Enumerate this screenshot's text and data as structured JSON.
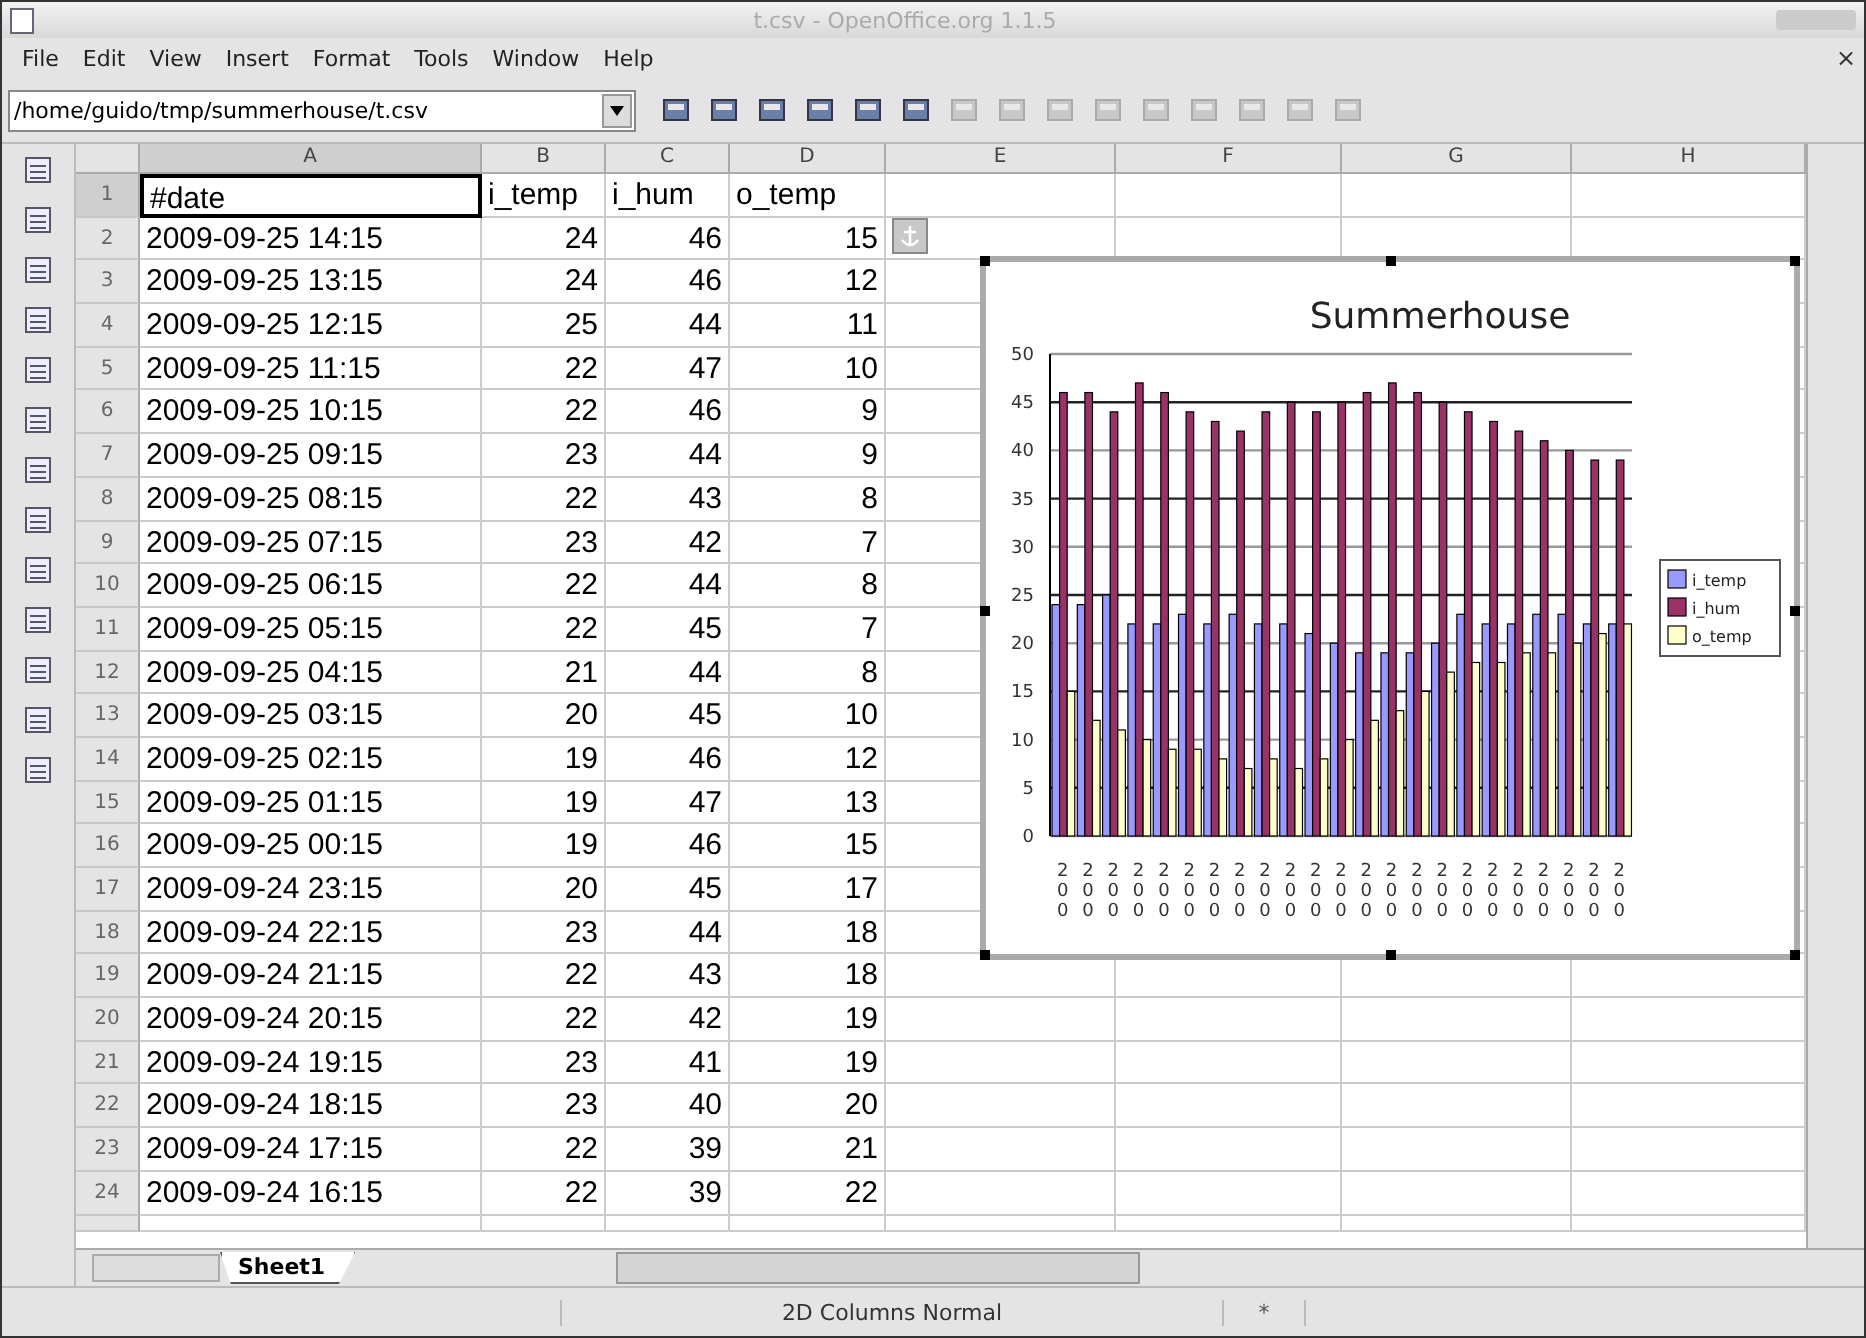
{
  "window": {
    "title": "t.csv - OpenOffice.org 1.1.5",
    "close": "×"
  },
  "menu": [
    "File",
    "Edit",
    "View",
    "Insert",
    "Format",
    "Tools",
    "Window",
    "Help"
  ],
  "toolbar": {
    "path": "/home/guido/tmp/summerhouse/t.csv"
  },
  "columns": [
    {
      "label": "A",
      "selected": true
    },
    {
      "label": "B",
      "selected": false
    },
    {
      "label": "C",
      "selected": false
    },
    {
      "label": "D",
      "selected": false
    },
    {
      "label": "E",
      "selected": false
    },
    {
      "label": "F",
      "selected": false
    },
    {
      "label": "G",
      "selected": false
    },
    {
      "label": "H",
      "selected": false
    }
  ],
  "rows": [
    {
      "number": "1",
      "selected": true,
      "kind": "header",
      "cells": [
        "#date",
        "i_temp",
        "i_hum",
        "o_temp"
      ]
    },
    {
      "number": "2",
      "selected": false,
      "kind": "data",
      "cells": [
        "2009-09-25 14:15",
        "24",
        "46",
        "15"
      ]
    },
    {
      "number": "3",
      "selected": false,
      "kind": "data",
      "cells": [
        "2009-09-25 13:15",
        "24",
        "46",
        "12"
      ]
    },
    {
      "number": "4",
      "selected": false,
      "kind": "data",
      "cells": [
        "2009-09-25 12:15",
        "25",
        "44",
        "11"
      ]
    },
    {
      "number": "5",
      "selected": false,
      "kind": "data",
      "cells": [
        "2009-09-25 11:15",
        "22",
        "47",
        "10"
      ]
    },
    {
      "number": "6",
      "selected": false,
      "kind": "data",
      "cells": [
        "2009-09-25 10:15",
        "22",
        "46",
        "9"
      ]
    },
    {
      "number": "7",
      "selected": false,
      "kind": "data",
      "cells": [
        "2009-09-25 09:15",
        "23",
        "44",
        "9"
      ]
    },
    {
      "number": "8",
      "selected": false,
      "kind": "data",
      "cells": [
        "2009-09-25 08:15",
        "22",
        "43",
        "8"
      ]
    },
    {
      "number": "9",
      "selected": false,
      "kind": "data",
      "cells": [
        "2009-09-25 07:15",
        "23",
        "42",
        "7"
      ]
    },
    {
      "number": "10",
      "selected": false,
      "kind": "data",
      "cells": [
        "2009-09-25 06:15",
        "22",
        "44",
        "8"
      ]
    },
    {
      "number": "11",
      "selected": false,
      "kind": "data",
      "cells": [
        "2009-09-25 05:15",
        "22",
        "45",
        "7"
      ]
    },
    {
      "number": "12",
      "selected": false,
      "kind": "data",
      "cells": [
        "2009-09-25 04:15",
        "21",
        "44",
        "8"
      ]
    },
    {
      "number": "13",
      "selected": false,
      "kind": "data",
      "cells": [
        "2009-09-25 03:15",
        "20",
        "45",
        "10"
      ]
    },
    {
      "number": "14",
      "selected": false,
      "kind": "data",
      "cells": [
        "2009-09-25 02:15",
        "19",
        "46",
        "12"
      ]
    },
    {
      "number": "15",
      "selected": false,
      "kind": "data",
      "cells": [
        "2009-09-25 01:15",
        "19",
        "47",
        "13"
      ]
    },
    {
      "number": "16",
      "selected": false,
      "kind": "data",
      "cells": [
        "2009-09-25 00:15",
        "19",
        "46",
        "15"
      ]
    },
    {
      "number": "17",
      "selected": false,
      "kind": "data",
      "cells": [
        "2009-09-24 23:15",
        "20",
        "45",
        "17"
      ]
    },
    {
      "number": "18",
      "selected": false,
      "kind": "data",
      "cells": [
        "2009-09-24 22:15",
        "23",
        "44",
        "18"
      ]
    },
    {
      "number": "19",
      "selected": false,
      "kind": "data",
      "cells": [
        "2009-09-24 21:15",
        "22",
        "43",
        "18"
      ]
    },
    {
      "number": "20",
      "selected": false,
      "kind": "data",
      "cells": [
        "2009-09-24 20:15",
        "22",
        "42",
        "19"
      ]
    },
    {
      "number": "21",
      "selected": false,
      "kind": "data",
      "cells": [
        "2009-09-24 19:15",
        "23",
        "41",
        "19"
      ]
    },
    {
      "number": "22",
      "selected": false,
      "kind": "data",
      "cells": [
        "2009-09-24 18:15",
        "23",
        "40",
        "20"
      ]
    },
    {
      "number": "23",
      "selected": false,
      "kind": "data",
      "cells": [
        "2009-09-24 17:15",
        "22",
        "39",
        "21"
      ]
    },
    {
      "number": "24",
      "selected": false,
      "kind": "data",
      "cells": [
        "2009-09-24 16:15",
        "22",
        "39",
        "22"
      ]
    }
  ],
  "chart": {
    "chart_data": {
      "type": "bar",
      "title": "Summerhouse",
      "categories": [
        "200",
        "200",
        "200",
        "200",
        "200",
        "200",
        "200",
        "200",
        "200",
        "200",
        "200",
        "200",
        "200",
        "200",
        "200",
        "200",
        "200",
        "200",
        "200",
        "200",
        "200",
        "200",
        "200"
      ],
      "series": [
        {
          "name": "i_temp",
          "color": "#9999ff",
          "values": [
            24,
            24,
            25,
            22,
            22,
            23,
            22,
            23,
            22,
            22,
            21,
            20,
            19,
            19,
            19,
            20,
            23,
            22,
            22,
            23,
            23,
            22,
            22
          ]
        },
        {
          "name": "i_hum",
          "color": "#993366",
          "values": [
            46,
            46,
            44,
            47,
            46,
            44,
            43,
            42,
            44,
            45,
            44,
            45,
            46,
            47,
            46,
            45,
            44,
            43,
            42,
            41,
            40,
            39,
            39
          ]
        },
        {
          "name": "o_temp",
          "color": "#ffffcc",
          "values": [
            15,
            12,
            11,
            10,
            9,
            9,
            8,
            7,
            8,
            7,
            8,
            10,
            12,
            13,
            15,
            17,
            18,
            18,
            19,
            19,
            20,
            21,
            22
          ]
        }
      ],
      "grid": true,
      "legend": true,
      "ylim": [
        0,
        50
      ],
      "yticks": [
        0,
        5,
        10,
        15,
        20,
        25,
        30,
        35,
        40,
        45,
        50
      ]
    }
  },
  "sheet_tabs": [
    {
      "label": "Sheet1",
      "selected": true
    }
  ],
  "status_bar": {
    "mode": "2D Columns Normal",
    "modified": "*"
  }
}
